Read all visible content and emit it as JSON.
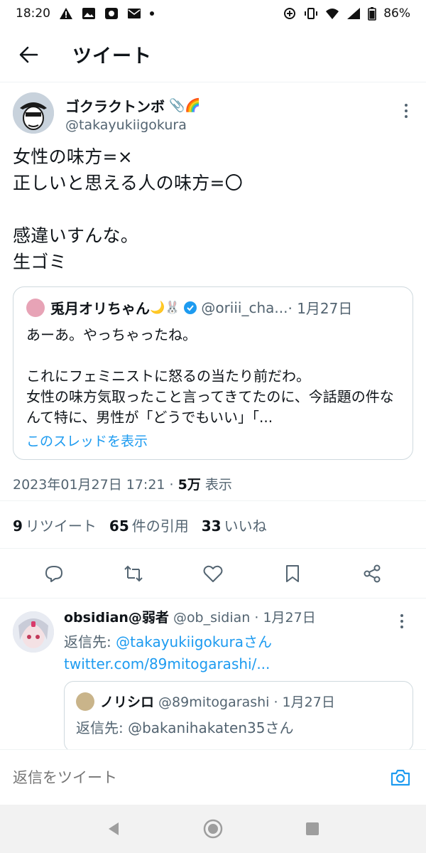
{
  "status_bar": {
    "time": "18:20",
    "battery": "86%",
    "left_icons": [
      "warning-icon",
      "image-icon",
      "app-icon",
      "mail-icon",
      "dot-icon"
    ],
    "right_icons": [
      "data-saver-icon",
      "vibrate-icon",
      "wifi-icon",
      "signal-icon",
      "battery-icon"
    ]
  },
  "header": {
    "title": "ツイート"
  },
  "tweet": {
    "display_name": "ゴクラクトンボ",
    "name_emoji": "📎🌈",
    "handle": "@takayukiigokura",
    "text": "女性の味方=×\n正しいと思える人の味方=〇\n\n感違いすんな。\n生ゴミ",
    "timestamp": "2023年01月27日 17:21 · ",
    "views_count": "5万",
    "views_label": " 表示"
  },
  "quote": {
    "display_name": "兎月オリちゃん",
    "name_emoji": "🌙🐰",
    "handle": "@oriii_cha...",
    "date": " · 1月27日",
    "text": "あーあ。やっちゃったね。\n\nこれにフェミニストに怒るの当たり前だわ。\n女性の味方気取ったこと言ってきてたのに、今話題の件なんて特に、男性が「どうでもいい」「...",
    "show_thread": "このスレッドを表示"
  },
  "stats": {
    "retweets_count": "9",
    "retweets_label": "リツイート",
    "quotes_count": "65",
    "quotes_label": "件の引用",
    "likes_count": "33",
    "likes_label": "いいね"
  },
  "actions": [
    "reply-icon",
    "retweet-icon",
    "like-icon",
    "bookmark-icon",
    "share-icon"
  ],
  "reply": {
    "display_name": "obsidian@弱者",
    "handle": "@ob_sidian · 1月27日",
    "reply_to_prefix": "返信先: ",
    "reply_to_mention": "@takayukiigokuraさん",
    "url": "twitter.com/89mitogarashi/...",
    "quote": {
      "display_name": "ノリシロ",
      "handle": "@89mitogarashi · 1月27日",
      "text": "返信先: @bakanihakaten35さん"
    }
  },
  "compose": {
    "placeholder": "返信をツイート"
  },
  "colors": {
    "accent": "#1d9bf0",
    "text": "#0f1419",
    "secondary": "#536471",
    "border": "#cfd9de"
  }
}
